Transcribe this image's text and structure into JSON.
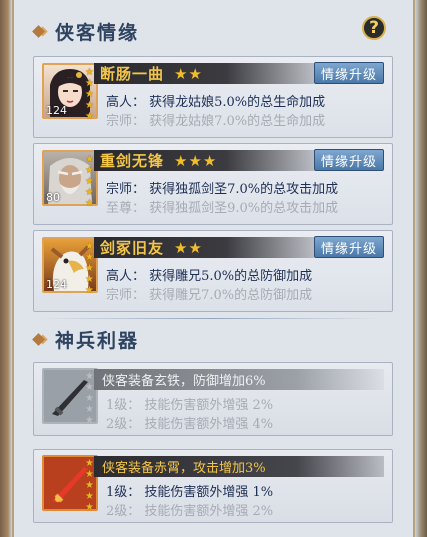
{
  "section1": {
    "title": "侠客情缘"
  },
  "help_label": "?",
  "bonds": [
    {
      "name": "断肠一曲",
      "stars": 2,
      "level": "124",
      "upgrade": "情缘升级",
      "line1": "高人：  获得龙姑娘5.0%的总生命加成",
      "line2": "宗师：  获得龙姑娘7.0%的总生命加成"
    },
    {
      "name": "重剑无锋",
      "stars": 3,
      "level": "80",
      "upgrade": "情缘升级",
      "line1": "宗师：  获得独孤剑圣7.0%的总攻击加成",
      "line2": "至尊：  获得独孤剑圣9.0%的总攻击加成"
    },
    {
      "name": "剑冢旧友",
      "stars": 2,
      "level": "124",
      "upgrade": "情缘升级",
      "line1": "高人：  获得雕兄5.0%的总防御加成",
      "line2": "宗师：  获得雕兄7.0%的总防御加成"
    }
  ],
  "section2": {
    "title": "神兵利器"
  },
  "weapons": [
    {
      "header": "侠客装备玄铁，防御增加6%",
      "active": false,
      "line1": "1级：  技能伤害额外增强 2%",
      "line2": "2级：  技能伤害额外增强 4%"
    },
    {
      "header": "侠客装备赤霄，攻击增加3%",
      "active": true,
      "line1": "1级：  技能伤害额外增强 1%",
      "line2": "2级：  技能伤害额外增强 2%"
    }
  ],
  "colors": {
    "gold": "#f3c64a",
    "navy": "#1e2f55",
    "muted": "#a6abb4",
    "button": "#5a88b8"
  }
}
